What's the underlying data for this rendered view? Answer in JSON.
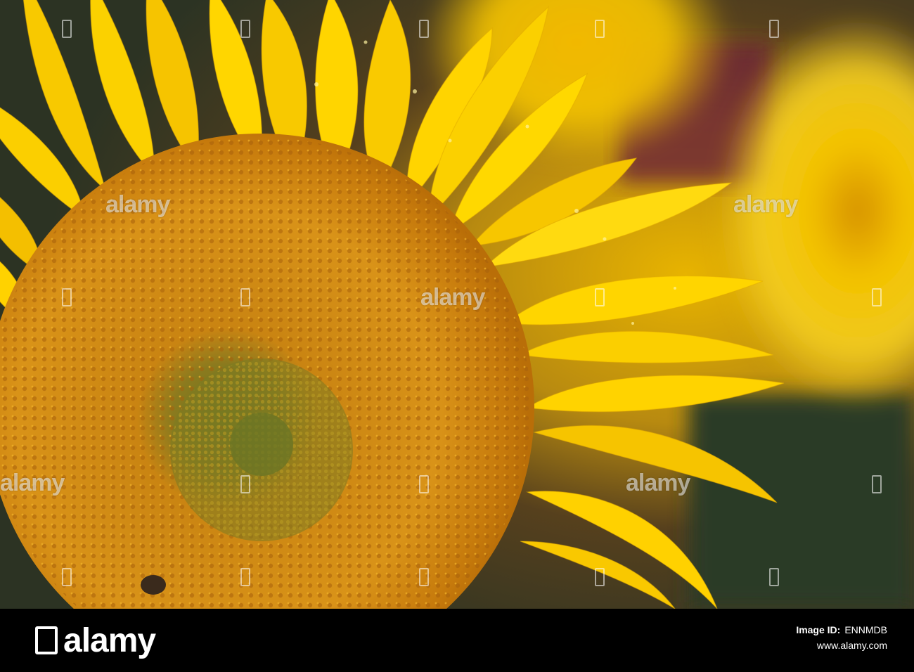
{
  "photo": {
    "subject": "sunflower",
    "colors": {
      "petal": "#f7c800",
      "disk": "#d08a10",
      "center": "#7a7a20",
      "bg_dark": "#2f3a2a",
      "bg_magenta": "#6a2238"
    }
  },
  "watermark": {
    "text": "alamy"
  },
  "footer": {
    "brand": "alamy",
    "image_id_label": "Image ID:",
    "image_id": "ENNMDB",
    "site": "www.alamy.com"
  }
}
